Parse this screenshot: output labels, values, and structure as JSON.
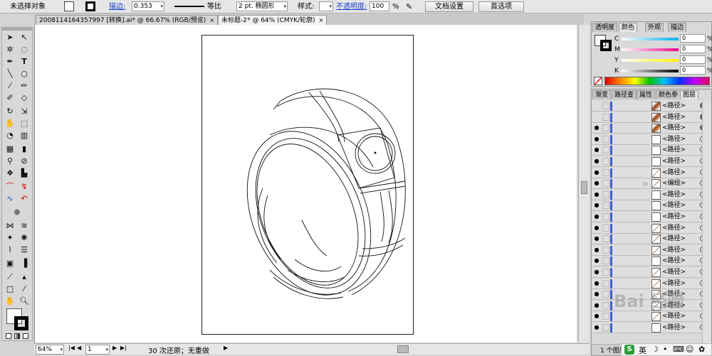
{
  "control_bar": {
    "selection": "未选择对象",
    "stroke_label": "描边:",
    "stroke_value": "0.353",
    "profile": "等比",
    "brush": "2 pt. 椭圆形",
    "style_label": "样式:",
    "opacity_label": "不透明度:",
    "opacity_value": "100",
    "opacity_unit": "%",
    "doc_setup": "文档设置",
    "preferences": "首选项"
  },
  "tabs": [
    {
      "label": "2008114164357997 [转换].ai* @ 66.67% (RGB/预览)",
      "close": "×"
    },
    {
      "label": "未标题-2* @ 64% (CMYK/轮廓)",
      "close": "×"
    }
  ],
  "color_panel": {
    "tabs": [
      "透明度",
      "颜色",
      "外观",
      "描边"
    ],
    "channels": [
      {
        "label": "C",
        "value": "0",
        "unit": "%",
        "gradient": "linear-gradient(90deg,#fff,#00aeef)"
      },
      {
        "label": "M",
        "value": "0",
        "unit": "%",
        "gradient": "linear-gradient(90deg,#fff,#ec008c)"
      },
      {
        "label": "Y",
        "value": "0",
        "unit": "%",
        "gradient": "linear-gradient(90deg,#fff,#fff200)"
      },
      {
        "label": "K",
        "value": "0",
        "unit": "%",
        "gradient": "linear-gradient(90deg,#fff,#000)"
      }
    ]
  },
  "layers_panel": {
    "tabs": [
      "渐变",
      "路径查",
      "属性",
      "颜色参",
      "图层"
    ],
    "rows": [
      {
        "name": "<路径>",
        "eye": "",
        "thumb": "brown",
        "filled": true
      },
      {
        "name": "<路径>",
        "eye": "",
        "thumb": "brown",
        "filled": true
      },
      {
        "name": "<路径>",
        "eye": "●",
        "thumb": "brown",
        "filled": true
      },
      {
        "name": "<路径>",
        "eye": "●",
        "thumb": "",
        "filled": false
      },
      {
        "name": "<路径>",
        "eye": "●",
        "thumb": "",
        "filled": false
      },
      {
        "name": "<路径>",
        "eye": "●",
        "thumb": "",
        "filled": false
      },
      {
        "name": "<路径>",
        "eye": "●",
        "thumb": "line",
        "filled": false
      },
      {
        "name": "<编组>",
        "eye": "●",
        "thumb": "line",
        "filled": false,
        "group": true
      },
      {
        "name": "<路径>",
        "eye": "●",
        "thumb": "",
        "filled": false
      },
      {
        "name": "<路径>",
        "eye": "●",
        "thumb": "",
        "filled": false
      },
      {
        "name": "<路径>",
        "eye": "●",
        "thumb": "",
        "filled": false
      },
      {
        "name": "<路径>",
        "eye": "●",
        "thumb": "line",
        "filled": false
      },
      {
        "name": "<路径>",
        "eye": "●",
        "thumb": "line",
        "filled": false
      },
      {
        "name": "<路径>",
        "eye": "●",
        "thumb": "line",
        "filled": false
      },
      {
        "name": "<路径>",
        "eye": "●",
        "thumb": "",
        "filled": false
      },
      {
        "name": "<路径>",
        "eye": "●",
        "thumb": "line",
        "filled": false
      },
      {
        "name": "<路径>",
        "eye": "●",
        "thumb": "line",
        "filled": false
      },
      {
        "name": "<路径>",
        "eye": "●",
        "thumb": "line",
        "filled": false
      },
      {
        "name": "<路径>",
        "eye": "●",
        "thumb": "line",
        "filled": false
      },
      {
        "name": "<路径>",
        "eye": "●",
        "thumb": "line",
        "filled": false
      },
      {
        "name": "<路径>",
        "eye": "●",
        "thumb": "",
        "filled": false
      }
    ],
    "footer": "1 个图层"
  },
  "status_bar": {
    "zoom": "64%",
    "page": "1",
    "history": "30 次还原；无重做"
  },
  "ime": {
    "lang": "英"
  },
  "watermark": "Bai 经验"
}
